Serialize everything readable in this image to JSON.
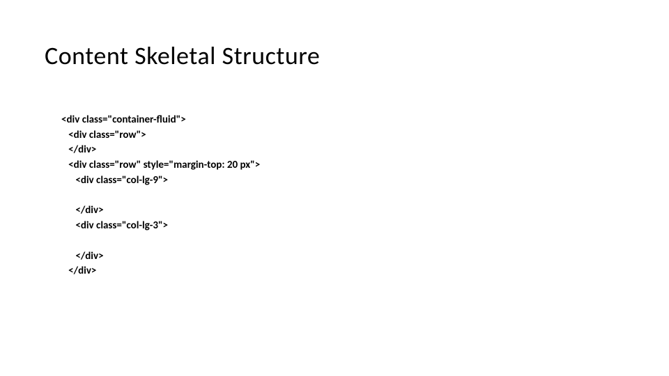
{
  "title": "Content Skeletal Structure",
  "code": {
    "l0": "<div class=\"container-fluid\">",
    "l1": "   <div class=\"row\">",
    "l2": "   </div>",
    "l3": "   <div class=\"row\" style=\"margin-top: 20 px\">",
    "l4": "      <div class=\"col-lg-9\">",
    "l5": "",
    "l6": "      </div>",
    "l7": "      <div class=\"col-lg-3\">",
    "l8": "",
    "l9": "      </div>",
    "l10": "   </div>"
  }
}
